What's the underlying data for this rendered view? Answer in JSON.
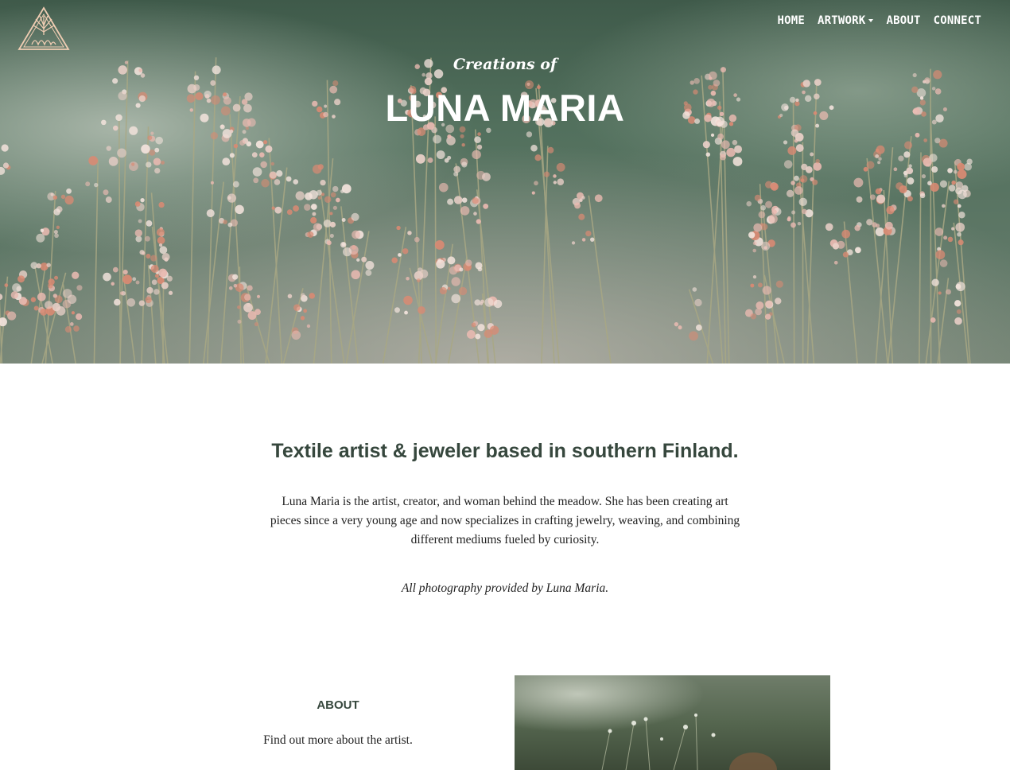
{
  "nav": {
    "items": [
      {
        "label": "HOME",
        "dropdown": false
      },
      {
        "label": "ARTWORK",
        "dropdown": true
      },
      {
        "label": "ABOUT",
        "dropdown": false
      },
      {
        "label": "CONNECT",
        "dropdown": false
      }
    ]
  },
  "hero": {
    "pre_title": "Creations of",
    "title": "LUNA MARIA"
  },
  "intro": {
    "tagline": "Textile artist & jeweler based in southern Finland.",
    "description": "Luna Maria is the artist, creator, and woman behind the meadow. She has been creating art pieces since a very young age and now specializes in crafting jewelry, weaving, and combining different mediums fueled by curiosity.",
    "credit": "All photography provided by Luna Maria."
  },
  "about": {
    "heading": "ABOUT",
    "text": "Find out more about the artist."
  },
  "colors": {
    "heading_green": "#36473d",
    "hero_green": "#52705d",
    "flower_pink": "#e8b9b0",
    "flower_coral": "#d98a73",
    "logo_peach": "#f0cdb3"
  },
  "icons": {
    "logo": "triangle-flower-logo-icon",
    "dropdown": "caret-down-icon"
  }
}
